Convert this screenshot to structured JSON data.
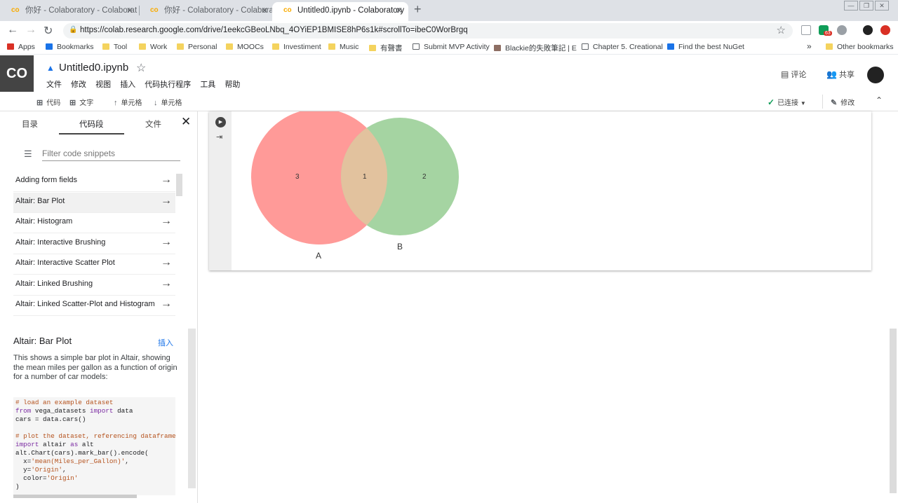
{
  "browser": {
    "tabs": [
      {
        "title": "你好 - Colaboratory - Colaborat"
      },
      {
        "title": "你好 - Colaboratory - Colaborat"
      },
      {
        "title": "Untitled0.ipynb - Colaboratory"
      }
    ],
    "url": "https://colab.research.google.com/drive/1eekcGBeoLNbq_4OYiEP1BMISE8hP6s1k#scrollTo=ibeC0WorBrgq",
    "extension_badge": "63",
    "bookmarks": [
      "Apps",
      "Bookmarks",
      "Tool",
      "Work",
      "Personal",
      "MOOCs",
      "Investiment",
      "Music",
      "有聲書",
      "Submit MVP Activity",
      "Blackie的失敗筆記 | E",
      "Chapter 5. Creational",
      "Find the best NuGet",
      "Other bookmarks"
    ]
  },
  "colab": {
    "logo": "CO",
    "notebook_title": "Untitled0.ipynb",
    "menu": [
      "文件",
      "修改",
      "视图",
      "插入",
      "代码执行程序",
      "工具",
      "帮助"
    ],
    "comment_label": "评论",
    "share_label": "共享"
  },
  "toolbar": {
    "add_code": "代码",
    "add_text": "文字",
    "cell_up": "单元格",
    "cell_down": "单元格",
    "connected": "已连接",
    "edit": "修改"
  },
  "sidepanel": {
    "tabs": [
      "目录",
      "代码段",
      "文件"
    ],
    "filter_placeholder": "Filter code snippets",
    "snippets": [
      "Adding form fields",
      "Altair: Bar Plot",
      "Altair: Histogram",
      "Altair: Interactive Brushing",
      "Altair: Interactive Scatter Plot",
      "Altair: Linked Brushing",
      "Altair: Linked Scatter-Plot and Histogram"
    ],
    "detail_title": "Altair: Bar Plot",
    "insert_label": "插入",
    "detail_desc": "This shows a simple bar plot in Altair, showing the mean miles per gallon as a function of origin for a number of car models:"
  },
  "venn": {
    "only_a": "3",
    "both": "1",
    "only_b": "2",
    "label_a": "A",
    "label_b": "B",
    "color_a": "#ff9a98",
    "color_b": "#a5d4a2",
    "color_ab": "#e2c29e"
  }
}
